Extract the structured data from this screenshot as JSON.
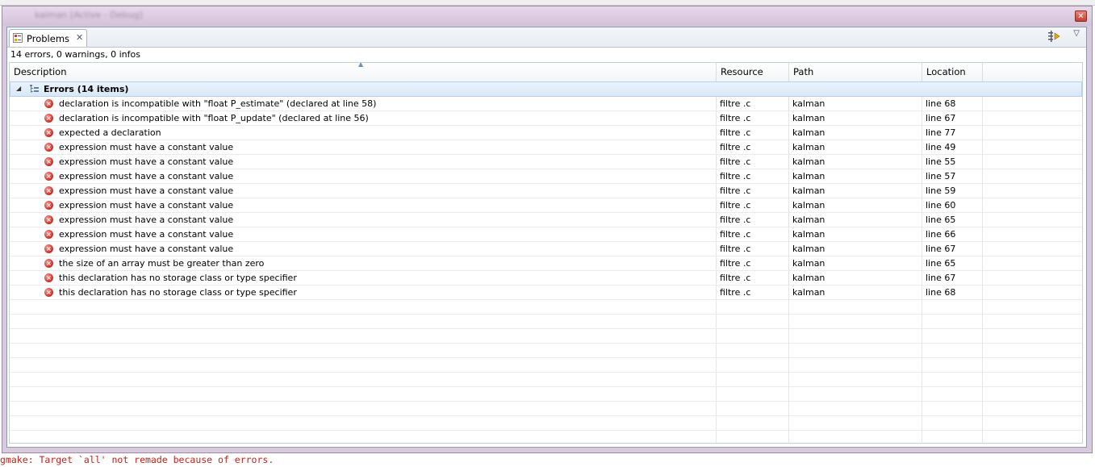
{
  "window": {
    "title": "kalman [Active - Debug]"
  },
  "tab": {
    "label": "Problems"
  },
  "summary": "14 errors, 0 warnings, 0 infos",
  "columns": [
    "Description",
    "Resource",
    "Path",
    "Location"
  ],
  "group": {
    "label": "Errors (14 items)"
  },
  "rows": [
    {
      "description": "declaration is incompatible with \"float P_estimate\" (declared at line 58)",
      "resource": "filtre .c",
      "path": "kalman",
      "location": "line 68"
    },
    {
      "description": "declaration is incompatible with \"float P_update\" (declared at line 56)",
      "resource": "filtre .c",
      "path": "kalman",
      "location": "line 67"
    },
    {
      "description": "expected a declaration",
      "resource": "filtre .c",
      "path": "kalman",
      "location": "line 77"
    },
    {
      "description": "expression must have a constant value",
      "resource": "filtre .c",
      "path": "kalman",
      "location": "line 49"
    },
    {
      "description": "expression must have a constant value",
      "resource": "filtre .c",
      "path": "kalman",
      "location": "line 55"
    },
    {
      "description": "expression must have a constant value",
      "resource": "filtre .c",
      "path": "kalman",
      "location": "line 57"
    },
    {
      "description": "expression must have a constant value",
      "resource": "filtre .c",
      "path": "kalman",
      "location": "line 59"
    },
    {
      "description": "expression must have a constant value",
      "resource": "filtre .c",
      "path": "kalman",
      "location": "line 60"
    },
    {
      "description": "expression must have a constant value",
      "resource": "filtre .c",
      "path": "kalman",
      "location": "line 65"
    },
    {
      "description": "expression must have a constant value",
      "resource": "filtre .c",
      "path": "kalman",
      "location": "line 66"
    },
    {
      "description": "expression must have a constant value",
      "resource": "filtre .c",
      "path": "kalman",
      "location": "line 67"
    },
    {
      "description": "the size of an array must be greater than zero",
      "resource": "filtre .c",
      "path": "kalman",
      "location": "line 65"
    },
    {
      "description": "this declaration has no storage class or type specifier",
      "resource": "filtre .c",
      "path": "kalman",
      "location": "line 67"
    },
    {
      "description": "this declaration has no storage class or type specifier",
      "resource": "filtre .c",
      "path": "kalman",
      "location": "line 68"
    }
  ],
  "console_line": "gmake: Target `all' not remade because of errors.",
  "colors": {
    "error": "#d3372c",
    "group_bg": "#d9e8f7",
    "console_text": "#c0231b"
  }
}
